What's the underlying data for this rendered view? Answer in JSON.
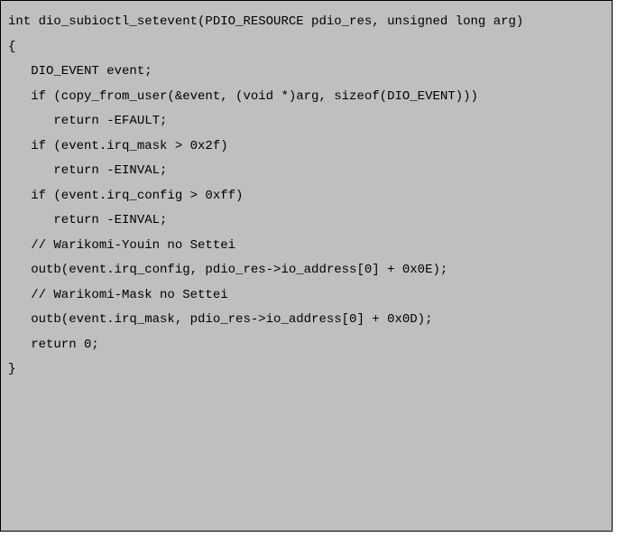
{
  "code": {
    "lines": [
      "int dio_subioctl_setevent(PDIO_RESOURCE pdio_res, unsigned long arg)",
      "{",
      "   DIO_EVENT event;",
      "",
      "   if (copy_from_user(&event, (void *)arg, sizeof(DIO_EVENT)))",
      "      return -EFAULT;",
      "",
      "   if (event.irq_mask > 0x2f)",
      "      return -EINVAL;",
      "   if (event.irq_config > 0xff)",
      "      return -EINVAL;",
      "",
      "   // Warikomi-Youin no Settei",
      "   outb(event.irq_config, pdio_res->io_address[0] + 0x0E);",
      "   // Warikomi-Mask no Settei",
      "   outb(event.irq_mask, pdio_res->io_address[0] + 0x0D);",
      "",
      "   return 0;",
      "}"
    ]
  }
}
